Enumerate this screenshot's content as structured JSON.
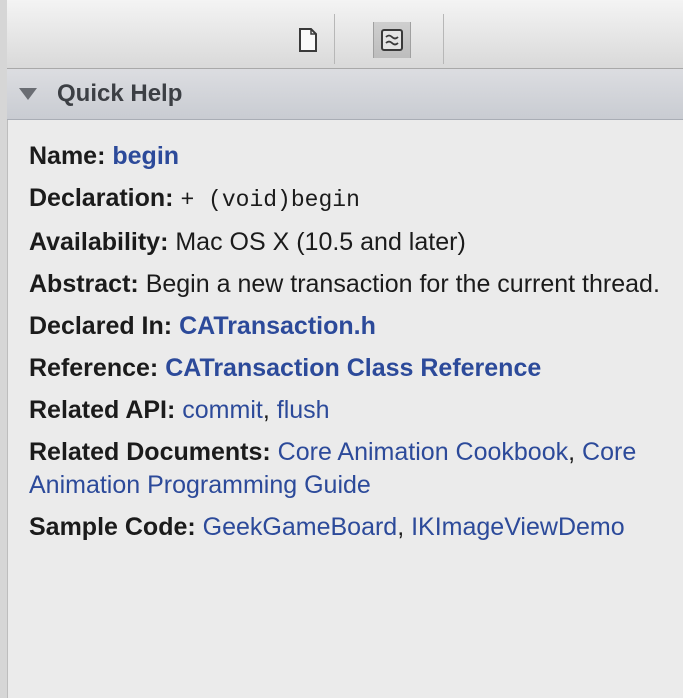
{
  "toolbar": {
    "file_inspector_icon": "document-icon",
    "quick_help_icon": "quick-help-icon"
  },
  "section": {
    "title": "Quick Help"
  },
  "help": {
    "name_label": "Name:",
    "name_value": "begin",
    "declaration_label": "Declaration:",
    "declaration_value": "+ (void)begin",
    "availability_label": "Availability:",
    "availability_value": "Mac OS X (10.5 and later)",
    "abstract_label": "Abstract:",
    "abstract_value": "Begin a new transaction for the current thread.",
    "declared_in_label": "Declared In:",
    "declared_in_value": "CATransaction.h",
    "reference_label": "Reference:",
    "reference_value": "CATransaction Class Reference",
    "related_api_label": "Related API:",
    "related_api": [
      "commit",
      "flush"
    ],
    "related_documents_label": "Related Documents:",
    "related_documents": [
      "Core Animation Cookbook",
      "Core Animation Programming Guide"
    ],
    "sample_code_label": "Sample Code:",
    "sample_code": [
      "GeekGameBoard",
      "IKImageViewDemo"
    ],
    "separator": ","
  },
  "colors": {
    "link": "#2c4a9a",
    "background": "#ebebeb",
    "header": "#c9ccd2"
  }
}
